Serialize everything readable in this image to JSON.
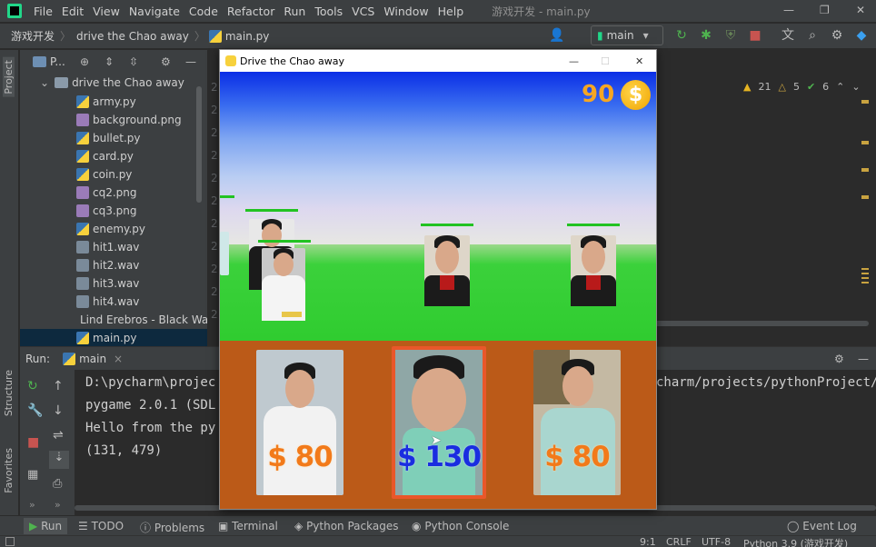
{
  "menubar": {
    "items": [
      "File",
      "Edit",
      "View",
      "Navigate",
      "Code",
      "Refactor",
      "Run",
      "Tools",
      "VCS",
      "Window",
      "Help"
    ],
    "title": "游戏开发 - main.py"
  },
  "toolbar": {
    "crumbs": [
      "游戏开发",
      "drive the Chao away",
      "main.py"
    ],
    "branch": "main"
  },
  "left_strip": {
    "project_label": "Project",
    "structure_label": "Structure",
    "favorites_label": "Favorites"
  },
  "project": {
    "header": "P...",
    "root": "drive the Chao away",
    "files": [
      "army.py",
      "background.png",
      "bullet.py",
      "card.py",
      "coin.py",
      "cq2.png",
      "cq3.png",
      "enemy.py",
      "hit1.wav",
      "hit2.wav",
      "hit3.wav",
      "hit4.wav",
      "Lind Erebros - Black Wa",
      "main.py"
    ]
  },
  "editor": {
    "gutter": [
      "2",
      "2",
      "2",
      "2",
      "2",
      "2",
      "2",
      "2",
      "2",
      "2",
      "2",
      "2",
      "2",
      "2"
    ],
    "inspections": {
      "warnings": "21",
      "weak": "5",
      "ok": "6"
    }
  },
  "run_panel": {
    "label": "Run:",
    "tab": "main",
    "lines": [
      "D:\\pycharm\\projec",
      "pygame 2.0.1 (SDL",
      "Hello from the py",
      "(131, 479)"
    ],
    "right_fragment": "charm/projects/pythonProject/"
  },
  "bottom_tabs": [
    "Run",
    "TODO",
    "Problems",
    "Terminal",
    "Python Packages",
    "Python Console",
    "Event Log"
  ],
  "status_bar": {
    "position": "9:1",
    "line_sep": "CRLF",
    "encoding": "UTF-8",
    "interpreter": "Python 3.9 (游戏开发)"
  },
  "game": {
    "title": "Drive the Chao away",
    "coins": "90",
    "coin_symbol": "$",
    "cards": [
      {
        "price": "$ 80",
        "color": "#f27a1a"
      },
      {
        "price": "$ 130",
        "color": "#1a2de0"
      },
      {
        "price": "$ 80",
        "color": "#f27a1a"
      }
    ]
  }
}
